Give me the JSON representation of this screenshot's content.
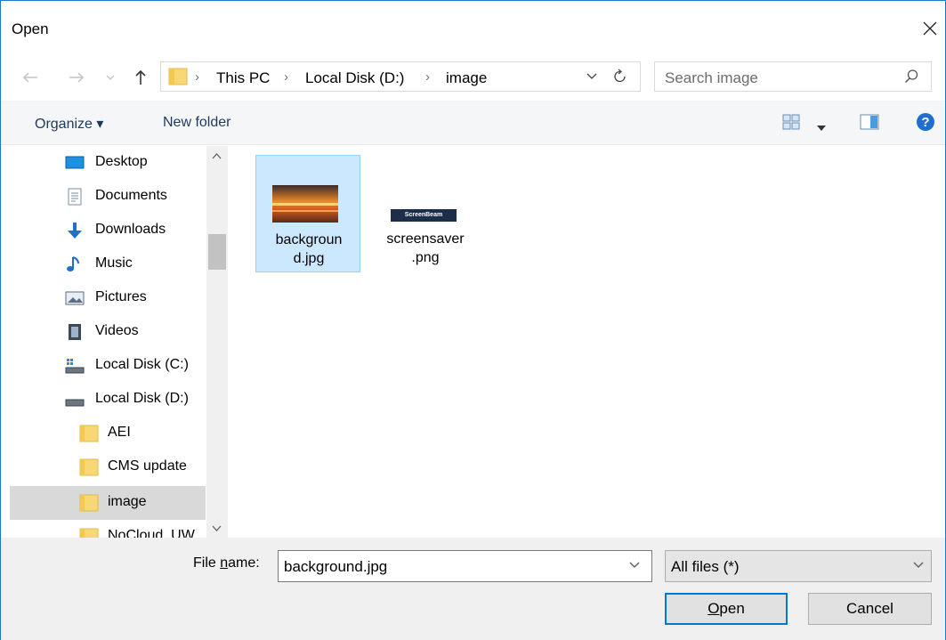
{
  "window": {
    "title": "Open"
  },
  "address": {
    "crumbs": [
      "This PC",
      "Local Disk (D:)",
      "image"
    ]
  },
  "search": {
    "placeholder": "Search image"
  },
  "commands": {
    "organize": "Organize ▾",
    "new_folder": "New folder"
  },
  "nav": {
    "items": [
      {
        "label": "Desktop",
        "icon": "desktop-icon"
      },
      {
        "label": "Documents",
        "icon": "documents-icon"
      },
      {
        "label": "Downloads",
        "icon": "downloads-icon"
      },
      {
        "label": "Music",
        "icon": "music-icon"
      },
      {
        "label": "Pictures",
        "icon": "pictures-icon"
      },
      {
        "label": "Videos",
        "icon": "videos-icon"
      },
      {
        "label": "Local Disk (C:)",
        "icon": "drive-c-icon"
      },
      {
        "label": "Local Disk (D:)",
        "icon": "drive-d-icon"
      },
      {
        "label": "AEI",
        "icon": "folder-icon"
      },
      {
        "label": "CMS update",
        "icon": "folder-icon"
      },
      {
        "label": "image",
        "icon": "folder-icon"
      },
      {
        "label": "NoCloud_UW",
        "icon": "folder-icon"
      }
    ],
    "selected": "image"
  },
  "files": [
    {
      "name_line1": "backgroun",
      "name_line2": "d.jpg",
      "selected": true
    },
    {
      "name_line1": "screensaver",
      "name_line2": ".png",
      "selected": false,
      "thumb_text": "ScreenBeam"
    }
  ],
  "bottom": {
    "file_name_label_pre": "File ",
    "file_name_label_u": "n",
    "file_name_label_post": "ame:",
    "file_name_value": "background.jpg",
    "filter_value": "All files (*)",
    "open_u": "O",
    "open_rest": "pen",
    "cancel_label": "Cancel"
  },
  "colors": {
    "accent": "#0078d7",
    "selection": "#cce8ff",
    "folder": "#f8d775",
    "help": "#1f6fd0"
  }
}
